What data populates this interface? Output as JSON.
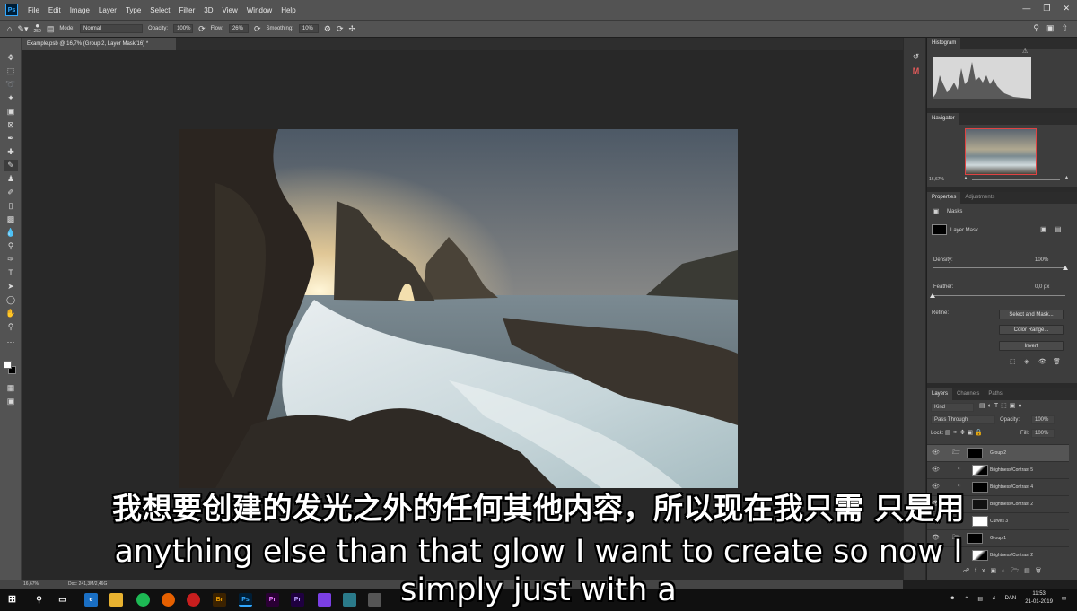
{
  "menu": {
    "app_logo": "Ps",
    "items": [
      "File",
      "Edit",
      "Image",
      "Layer",
      "Type",
      "Select",
      "Filter",
      "3D",
      "View",
      "Window",
      "Help"
    ]
  },
  "options_bar": {
    "brush_size": "250",
    "mode_label": "Mode:",
    "mode_value": "Normal",
    "opacity_label": "Opacity:",
    "opacity_value": "100%",
    "flow_label": "Flow:",
    "flow_value": "26%",
    "smoothing_label": "Smoothing:",
    "smoothing_value": "10%"
  },
  "document": {
    "tab_title": "Example.psb @ 16,7% (Group 2, Layer Mask/16) *"
  },
  "histogram": {
    "title": "Histogram"
  },
  "navigator": {
    "title": "Navigator",
    "zoom": "16,67%"
  },
  "properties": {
    "tabs": [
      "Properties",
      "Adjustments"
    ],
    "masks_label": "Masks",
    "layer_mask_label": "Layer Mask",
    "density_label": "Density:",
    "density_value": "100%",
    "density_level": 1.0,
    "feather_label": "Feather:",
    "feather_value": "0,0 px",
    "feather_level": 0.0,
    "refine_label": "Refine:",
    "buttons": [
      "Select and Mask...",
      "Color Range...",
      "Invert"
    ]
  },
  "layers": {
    "tabs": [
      "Layers",
      "Channels",
      "Paths"
    ],
    "kind_filter": "Kind",
    "blend_mode": "Pass Through",
    "opacity_label": "Opacity:",
    "opacity_value": "100%",
    "lock_label": "Lock:",
    "fill_label": "Fill:",
    "fill_value": "100%",
    "items": [
      {
        "name": "Group 2",
        "selected": true
      },
      {
        "name": "Brightness/Contrast 5"
      },
      {
        "name": "Brightness/Contrast 4"
      },
      {
        "name": "Brightness/Contrast 2"
      },
      {
        "name": "Curves 3"
      },
      {
        "name": "Group 1"
      },
      {
        "name": "Brightness/Contrast 2"
      }
    ]
  },
  "statusbar": {
    "zoom": "16,67%",
    "doc_info": "Doc: 241,3M/2,46G"
  },
  "taskbar": {
    "language": "DAN",
    "time": "11:53",
    "date": "21-01-2019"
  },
  "subtitles": {
    "zh": "我想要创建的发光之外的任何其他内容，所以现在我只需 只是用",
    "en_line1": "anything else than that glow I want to create so now I",
    "en_line2": "simply just with a"
  }
}
